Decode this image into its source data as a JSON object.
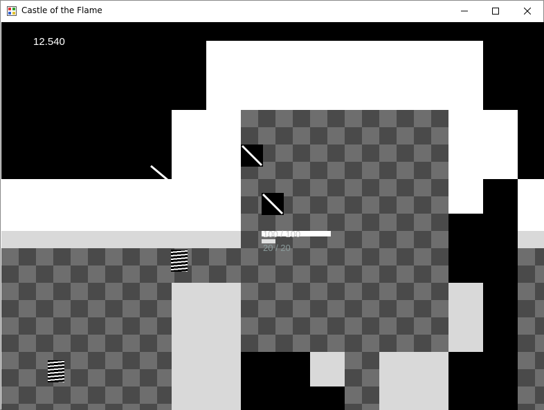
{
  "window": {
    "title": "Castle of the Flame",
    "controls": {
      "minimize_icon": "minimize-icon",
      "maximize_icon": "maximize-icon",
      "close_icon": "close-icon"
    }
  },
  "hud": {
    "timer": "12.540",
    "health_text": "100 / 100",
    "mana_text": "20 / 20",
    "health_fraction": 1.0
  },
  "colors": {
    "wall": "#000000",
    "void": "#ffffff",
    "floor_dark": "#4a4a4a",
    "floor_light": "#6e6e6e",
    "ledge": "#d9d9d9"
  }
}
